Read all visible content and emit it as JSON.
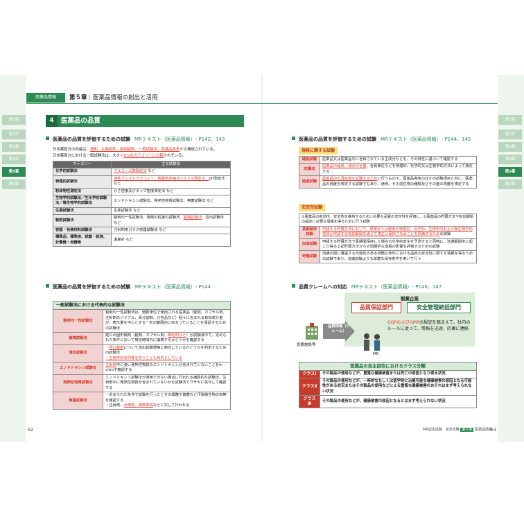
{
  "chapter_tabs": [
    "第1章",
    "第2章",
    "第3章",
    "第4章",
    "第5章",
    "第6章"
  ],
  "active_tab_index": 4,
  "header": {
    "category": "医薬品情報",
    "chapter": "第５章",
    "title": "医薬品情報の創出と活用"
  },
  "section": {
    "number": "4",
    "title": "医薬品の品質"
  },
  "left": {
    "h2_a": {
      "title": "医薬品の品質を評価するための試験",
      "ref": "MRテキスト（医薬品情報）- P142、143"
    },
    "intro": {
      "p1a": "日本薬局方の内容は、",
      "p1b": "通則、生薬総則、製剤総則、一般試験法、医薬品各条",
      "p1c": "から構成されている。",
      "p2a": "日本薬局方における一般試験法は、大きく",
      "p2b": "8つのカテゴリーに分類",
      "p2c": "されている。"
    },
    "table1": {
      "headers": [
        "カテゴリー",
        "主な試験法"
      ],
      "rows": [
        {
          "cat": "化学的試験法",
          "pre": "",
          "red": "アルコール数測定法",
          "post": " など"
        },
        {
          "cat": "物理的試験法",
          "pre": "",
          "red": "液体クロマトグラフィー、核磁気共鳴スペクトル測定法、",
          "post": "pH測定法 など"
        },
        {
          "cat": "粉体物性測定法",
          "pre": "かさ密度及びタップ密度測定法 など",
          "red": "",
          "post": ""
        },
        {
          "cat": "生物学的試験法／生化学的試験法／微生物学的試験法",
          "pre": "エンドトキシン試験法、発熱性物質試験法、無菌試験法 など",
          "red": "",
          "post": ""
        },
        {
          "cat": "生薬試験法",
          "pre": "生薬試験法 など",
          "red": "",
          "post": ""
        },
        {
          "cat": "製剤試験法",
          "pre": "製剤均一性試験法、製剤の粒度の試験法、",
          "red": "崩壊試験法",
          "post": "、溶出試験法 など"
        },
        {
          "cat": "容器・包装材料試験法",
          "pre": "注射剤用ガラス容器試験法 など",
          "red": "",
          "post": ""
        },
        {
          "cat": "標準品、標準液、試薬・試液、計量器・用器等",
          "pre": "温度計 など",
          "red": "",
          "post": ""
        }
      ]
    },
    "h2_b": {
      "title": "医薬品の品質を評価するための試験",
      "ref": "MRテキスト（医薬品情報）- P144"
    },
    "table2": {
      "title": "一般試験法における代表的な試験法",
      "rows": [
        {
          "cat": "製剤均一性試験法",
          "text": "製剤均一性試験法は、個数単位で使用される医薬品（錠剤、カプセル剤、注射剤のバイアル、易分割剤、分包品など）個々に含まれる有効成分量が、表示量を中心とする一定の範囲内に収まっていることを保証するための試験法"
        },
        {
          "cat": "崩壊試験法",
          "text_a": "経口の固形製剤（錠剤、カプセル剤、",
          "text_red": "顆粒剤など",
          "text_b": "）が試験液中で、定められた条件において規定時間内に崩壊するかどうかを確認する"
        },
        {
          "cat": "溶出試験法",
          "l1a": "・",
          "l1red": "経口製剤",
          "l1b": "について溶出試験規格に適合しているかどうかを判定するための試験法",
          "l2": "・生物学的非同等を防ぐことも目的としている"
        },
        {
          "cat": "エンドトキシン試験法",
          "a": "注射剤",
          "b": "中に強い発熱性物質のエンドトキシンが含まれていないことをin vitroで確認する"
        },
        {
          "cat": "発熱性物質試験法",
          "text": "エンドトキシン試験法が適用できない場合に行われる補助的な試験法。注射剤中に発熱性物質が含まれていないかを試験法でウサギに投与して確認する"
        },
        {
          "cat": "無菌試験法",
          "l1": "・定められた条件で試験を行ったときの細菌や真菌など汚染微生物の有無を確認する",
          "l2a": "・注射剤、",
          "l2red": "点眼剤、眼軟膏剤",
          "l2b": "などに対して行われる"
        }
      ]
    },
    "page_number": "62"
  },
  "right": {
    "h2_a": {
      "title": "医薬品の品質を評価するための試験",
      "ref": "MRテキスト（医薬品情報）- P144、145"
    },
    "label_spec": "規格に関する試験",
    "table3": [
      {
        "cat": "確認試験",
        "text": "医薬品又は医薬品中に含有されている主成分などを、その特性に基づいて確認する"
      },
      {
        "cat": "定量法",
        "red": "医薬品の組成、成分の含量",
        "post": "、含有単位などを物理的、化学的又は生物学的方法によって測定する"
      },
      {
        "cat": "純度試験",
        "red": "医薬品中の混在物を試験するため",
        "post": "に行うもので、医薬品各条のほかの試験項目と共に、医薬品の純度を規定する試験でもあり、通例、その混在物の種類及びその量の限度を規定する"
      }
    ],
    "label_stab": "安定性試験",
    "table4_intro": "①医薬品の有効性、安全性を維持するために必要な品質の安定性を評価し、②医薬品の貯蔵方法や有効期間の設定に必要な情報を得るために行う試験",
    "table4": [
      {
        "cat": "長期保存試験",
        "red": "申請する貯蔵方法において、原薬または製剤の物理的、化学的、生物学的および微生物学的性質が申請する有効期間を通じて適正に保持されることを評価するため",
        "post": "の試験"
      },
      {
        "cat": "加速試験",
        "text": "申請する貯蔵方法で長期間保存した場合の化学的変化を予測すると同時に、流通期間中に起こり得る上記貯蔵方法からの短期的な逸脱の影響を評価するための試験"
      },
      {
        "cat": "苛酷試験",
        "text": "流通の間に遭遇する可能性のある苛酷な条件における品質の安定性に関する情報を得るための試験であり、加速試験よりも苛酷な保存条件を用いて行う"
      }
    ],
    "h2_b": {
      "title": "品質クレームへの対応",
      "ref": "MRテキスト（医薬品情報）- P146、147"
    },
    "diagram": {
      "company_label": "製薬企業",
      "qa_dept": "品質保証部門",
      "safety_dept": "安全管理統括部門",
      "gmp_a": "GQPおよびGMP",
      "gmp_b": "の規定を踏まえて、社内のルールに従って、情報を迅速、的確に連絡",
      "hospital": "医療施設等",
      "arrow_text": "品質情報（クレーム）",
      "mr": "MR"
    },
    "recall": {
      "title": "医薬品の自主回収におけるクラス分類",
      "rows": [
        {
          "cat": "クラスⅠ",
          "text": "その製品の使用などが、重篤な健康被害または死亡の原因となり得る状況"
        },
        {
          "cat": "クラスⅡ",
          "text": "その製品の使用などが、一時的なもしくは医学的に治癒可能な健康被害の原因となる可能性がある状況またはその製品の使用などによる重篤な健康被害のおそれはまず考えられない状況"
        },
        {
          "cat": "クラスⅢ",
          "text": "その製品の使用などが、健康被害の原因となるとはまず考えられない状況"
        }
      ]
    },
    "footer": {
      "book": "MR認定試験　完全攻略",
      "chapter": "第５章",
      "cat": "医薬品情報"
    },
    "page_number": "63"
  },
  "colors": {
    "brand_green": "#2e8a55",
    "accent_red": "#e23a2a",
    "highlight_yellow": "#f5e07a"
  }
}
